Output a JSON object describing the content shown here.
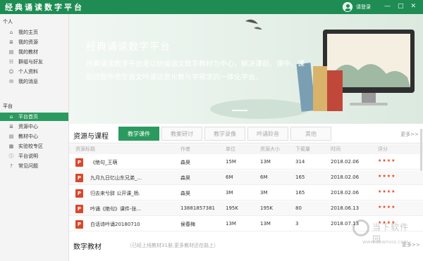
{
  "app": {
    "title": "经典诵读数字平台",
    "login_label": "请登录",
    "controls": [
      "—",
      "□",
      "✕"
    ]
  },
  "sidebar": {
    "personal_title": "个人",
    "personal_items": [
      {
        "label": "我的主页",
        "icon": "home-icon",
        "glyph": "⌂"
      },
      {
        "label": "我的资源",
        "icon": "list-icon",
        "glyph": "≣"
      },
      {
        "label": "我的教材",
        "icon": "book-icon",
        "glyph": "▤"
      },
      {
        "label": "群组与好友",
        "icon": "group-icon",
        "glyph": "☷"
      },
      {
        "label": "个人资料",
        "icon": "user-icon",
        "glyph": "☺"
      },
      {
        "label": "我的消息",
        "icon": "message-icon",
        "glyph": "✉"
      }
    ],
    "platform_title": "平台",
    "platform_items": [
      {
        "label": "平台首页",
        "icon": "home-icon",
        "glyph": "⌂",
        "active": true
      },
      {
        "label": "资源中心",
        "icon": "list-icon",
        "glyph": "≣"
      },
      {
        "label": "教材中心",
        "icon": "book-icon",
        "glyph": "▤"
      },
      {
        "label": "实验校专区",
        "icon": "school-icon",
        "glyph": "▦"
      },
      {
        "label": "平台说明",
        "icon": "info-icon",
        "glyph": "ⓘ"
      },
      {
        "label": "常见问题",
        "icon": "question-icon",
        "glyph": "?"
      }
    ]
  },
  "banner": {
    "title": "经典诵读数字平台",
    "description": "经典诵读数字平台是以统编语文数字教材为中心，解决课前、课中、课后过程中师生语文吟诵信息化教与学需求的一体化平台。"
  },
  "resources": {
    "section_title": "资源与课程",
    "tabs": [
      "教学课件",
      "教案研讨",
      "教学录像",
      "吟诵聆音",
      "其他"
    ],
    "more_label": "更多>>",
    "columns": [
      "资源标题",
      "作者",
      "单位",
      "资源大小",
      "下载量",
      "时间",
      "评分"
    ],
    "rows": [
      {
        "title": "《绝句_王萌",
        "author": "森昊",
        "unit": "15M",
        "size": "13M",
        "downloads": "314",
        "date": "2018.02.06",
        "rating": "★★★★"
      },
      {
        "title": "九月九日忆山东兄弟_...",
        "author": "森昊",
        "unit": "6M",
        "size": "6M",
        "downloads": "165",
        "date": "2018.02.06",
        "rating": "★★★★"
      },
      {
        "title": "归去来兮辞 公开课_杨.",
        "author": "森昊",
        "unit": "3M",
        "size": "3M",
        "downloads": "165",
        "date": "2018.02.06",
        "rating": "★★★★"
      },
      {
        "title": "吟诵《绝句》课件-张...",
        "author": "13881857381",
        "unit": "195K",
        "size": "195K",
        "downloads": "80",
        "date": "2018.06.13",
        "rating": "★★★★"
      },
      {
        "title": "白话诗吟诵20180710",
        "author": "侯春梅",
        "unit": "13M",
        "size": "13M",
        "downloads": "3",
        "date": "2018.07.13",
        "rating": "★★★★"
      }
    ]
  },
  "textbooks": {
    "title": "数字教材",
    "note": "（已经上线教材31册,更多教材还在路上）",
    "more_label": "更多>>"
  },
  "watermark": {
    "brand": "当下软件园",
    "url": "www.downxia.com"
  },
  "colors": {
    "brand": "#1f8c54",
    "active": "#2a9a5f",
    "file_icon": "#d9482c",
    "star": "#e0461e"
  }
}
